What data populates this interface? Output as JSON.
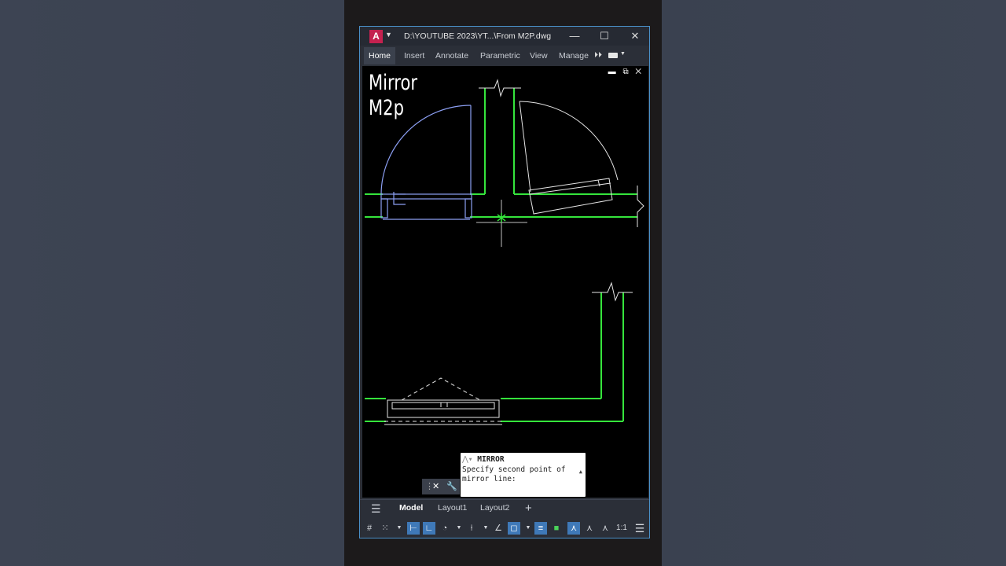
{
  "window": {
    "app_letter": "A",
    "title": "D:\\YOUTUBE 2023\\YT...\\From M2P.dwg",
    "minimize": "—",
    "maximize": "☐",
    "close": "✕"
  },
  "ribbon": {
    "tabs": [
      "Home",
      "Insert",
      "Annotate",
      "Parametric",
      "View",
      "Manage"
    ],
    "active_tab": "Home",
    "more": "⏵⏵"
  },
  "canvas": {
    "overlay_title_line1": "Mirror",
    "overlay_title_line2": "M2p",
    "viewport_controls": "▬ ⧉ ✕",
    "colors": {
      "wall": "#35e53c",
      "selected": "#8c9ff3",
      "door": "#e6e6e6",
      "background": "#000000"
    }
  },
  "command": {
    "name": "MIRROR",
    "prompt": "Specify second point of mirror line:",
    "close_label": "✕",
    "tools_label": "🔧"
  },
  "layouts": {
    "menu_icon": "☰",
    "tabs": [
      "Model",
      "Layout1",
      "Layout2"
    ],
    "active": "Model",
    "add": "+"
  },
  "status": {
    "scale": "1:1"
  }
}
